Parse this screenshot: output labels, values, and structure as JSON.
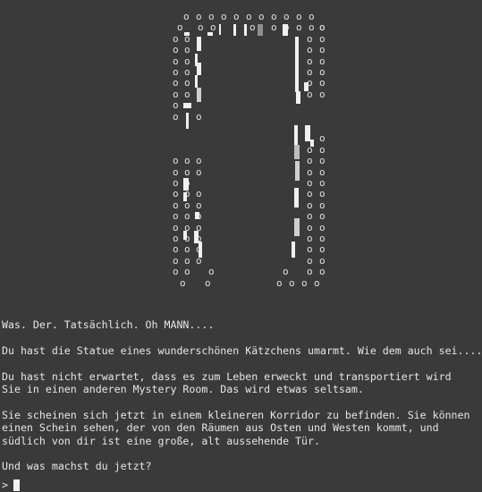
{
  "ascii_art": {
    "glyph": "o",
    "subject": "statue-doorway"
  },
  "narrative": {
    "exclamation": "Was. Der. Tatsächlich. Oh MANN....",
    "paragraph_1": "Du hast die Statue eines wunderschönen Kätzchens umarmt. Wie dem auch sei....",
    "paragraph_2_line_1": "Du hast nicht erwartet, dass es zum Leben erweckt und transportiert wird",
    "paragraph_2_line_2": "Sie in einen anderen Mystery Room. Das wird etwas seltsam.",
    "paragraph_3_line_1": "Sie scheinen sich jetzt in einem kleineren Korridor zu befinden. Sie können",
    "paragraph_3_line_2": "einen Schein sehen, der von den Räumen aus Osten und Westen kommt, und",
    "paragraph_3_line_3": "südlich von dir ist eine große, alt aussehende Tür.",
    "question": "Und was machst du jetzt?"
  },
  "input": {
    "prompt_symbol": ">",
    "value": ""
  },
  "colors": {
    "background": "#3a3a3a",
    "text": "#e6e6e6",
    "cursor": "#f2f2f2"
  }
}
